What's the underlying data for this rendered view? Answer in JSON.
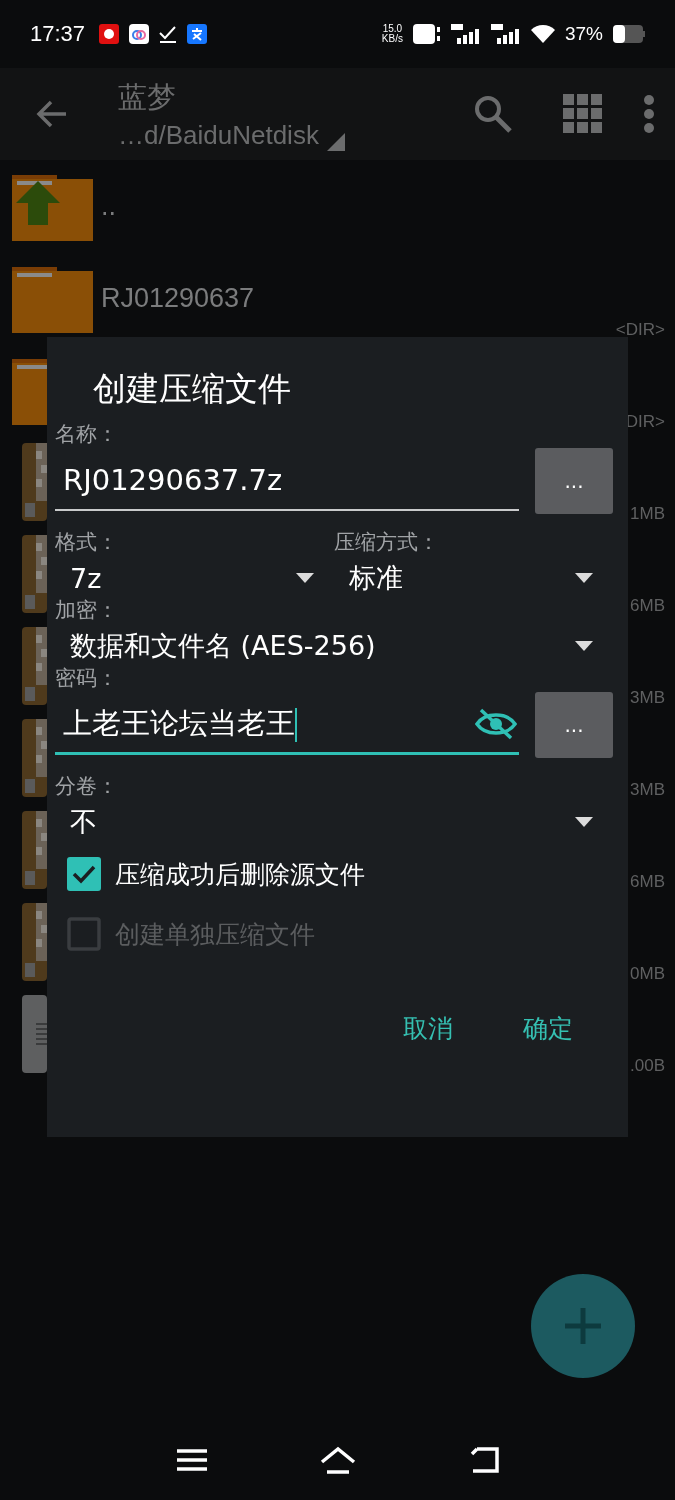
{
  "status_bar": {
    "time": "17:37",
    "net_speed": "15.0",
    "net_speed_unit": "KB/s",
    "battery": "37%"
  },
  "toolbar": {
    "title": "蓝梦",
    "path": "…d/BaiduNetdisk"
  },
  "files": [
    {
      "kind": "up",
      "name": ".."
    },
    {
      "kind": "folder",
      "name": "RJ01290637",
      "size": "<DIR>"
    },
    {
      "kind": "folder",
      "size": "DIR>"
    },
    {
      "kind": "archive",
      "size": "1MB"
    },
    {
      "kind": "archive",
      "size": "6MB"
    },
    {
      "kind": "archive",
      "size": "3MB"
    },
    {
      "kind": "archive",
      "size": "3MB"
    },
    {
      "kind": "archive",
      "size": "6MB"
    },
    {
      "kind": "archive",
      "size": "0MB"
    },
    {
      "kind": "document",
      "size": ".00B"
    }
  ],
  "dialog": {
    "title": "创建压缩文件",
    "name_label": "名称：",
    "name_value": "RJ01290637.7z",
    "name_browse": "...",
    "format_label": "格式：",
    "format_value": "7z",
    "method_label": "压缩方式：",
    "method_value": "标准",
    "encryption_label": "加密：",
    "encryption_value": "数据和文件名 (AES-256)",
    "password_label": "密码：",
    "password_value": "上老王论坛当老王",
    "password_visible": true,
    "password_browse": "...",
    "split_label": "分卷：",
    "split_value": "不",
    "options": [
      {
        "label": "压缩成功后删除源文件",
        "checked": true,
        "disabled": false
      },
      {
        "label": "创建单独压缩文件",
        "checked": false,
        "disabled": true
      }
    ],
    "buttons": [
      "取消",
      "确定"
    ]
  }
}
